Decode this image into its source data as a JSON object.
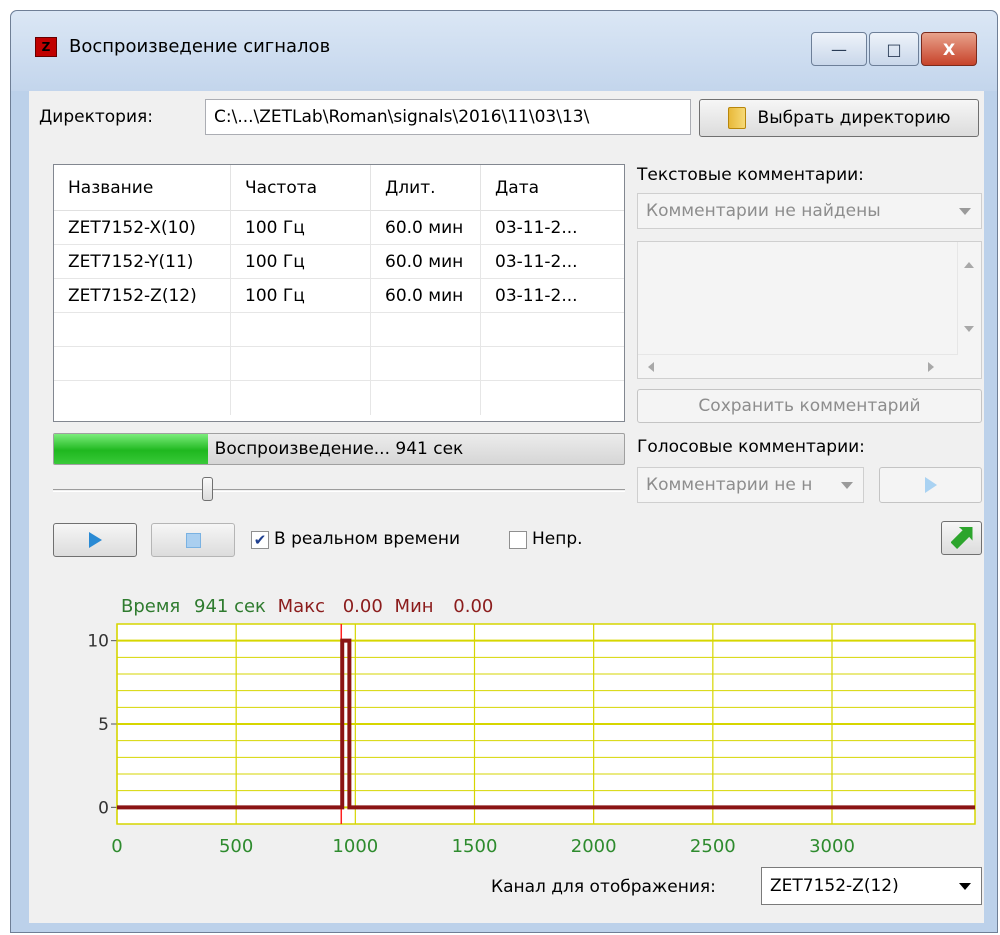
{
  "window": {
    "title": "Воспроизведение сигналов",
    "controls": {
      "minimize": "—",
      "maximize": "□",
      "close": "X"
    }
  },
  "directory": {
    "label": "Директория:",
    "path": "C:\\...\\ZETLab\\Roman\\signals\\2016\\11\\03\\13\\",
    "choose_button": "Выбрать директорию"
  },
  "table": {
    "columns": [
      "Название",
      "Частота",
      "Длит.",
      "Дата"
    ],
    "rows": [
      [
        "ZET7152-X(10)",
        "100 Гц",
        "60.0 мин",
        "03-11-2..."
      ],
      [
        "ZET7152-Y(11)",
        "100 Гц",
        "60.0 мин",
        "03-11-2..."
      ],
      [
        "ZET7152-Z(12)",
        "100 Гц",
        "60.0 мин",
        "03-11-2..."
      ]
    ]
  },
  "progress": {
    "label": "Воспроизведение... 941 сек",
    "fraction": 0.27
  },
  "playback": {
    "slider_fraction": 0.27,
    "realtime_label": "В реальном времени",
    "realtime_checked": true,
    "continuous_label": "Непр.",
    "continuous_checked": false
  },
  "text_comments": {
    "label": "Текстовые комментарии:",
    "combo_value": "Комментарии не найдены",
    "save_button": "Сохранить комментарий"
  },
  "voice_comments": {
    "label": "Голосовые комментарии:",
    "combo_value": "Комментарии не н"
  },
  "readout": {
    "time_label": "Время",
    "time_value": "941 сек",
    "max_label": "Макс",
    "max_value": "0.00",
    "min_label": "Мин",
    "min_value": "0.00"
  },
  "channel": {
    "label": "Канал для отображения:",
    "value": "ZET7152-Z(12)"
  },
  "colors": {
    "accent_green": "#2a9a2a",
    "readout_green": "#2f7b2f",
    "readout_red": "#8b1c1c",
    "grid": "#d6d600",
    "signal": "#8b1414",
    "cursor": "#ff2020",
    "axis_text": "#2e8b2e"
  },
  "chart_data": {
    "type": "line",
    "title": "",
    "xlabel": "",
    "ylabel": "",
    "xlim": [
      0,
      3600
    ],
    "ylim": [
      -1,
      11
    ],
    "xticks": [
      0,
      500,
      1000,
      1500,
      2000,
      2500,
      3000
    ],
    "yticks": [
      0,
      5,
      10
    ],
    "grid": true,
    "cursor_x": 941,
    "series": [
      {
        "x": [
          0,
          945,
          945,
          975,
          975,
          3600
        ],
        "y": [
          0,
          0,
          10,
          10,
          0,
          0
        ]
      }
    ]
  }
}
